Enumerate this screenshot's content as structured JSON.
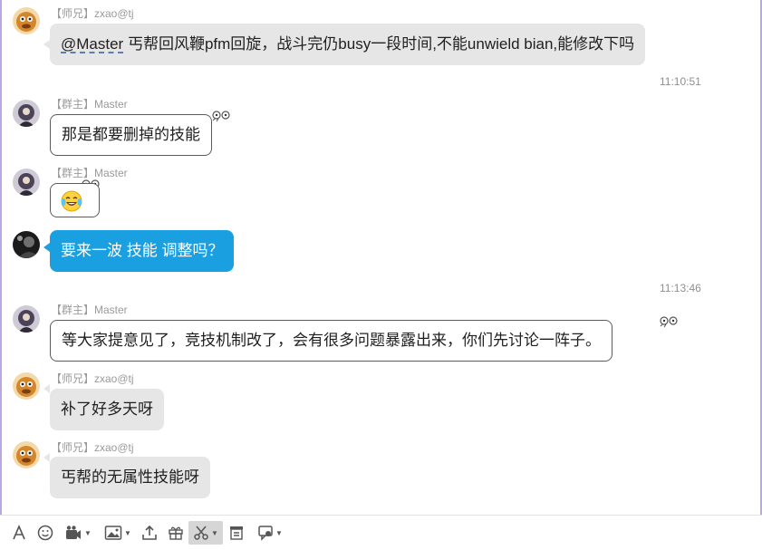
{
  "colors": {
    "bubble_gray": "#e6e6e6",
    "bubble_blue": "#1aa0e0",
    "outline": "#5b5b5b",
    "meta_text": "#9a9a9a"
  },
  "messages": [
    {
      "sender": "【师兄】zxao@tj",
      "mention": "@Master",
      "text": " 丐帮回风鞭pfm回旋，战斗完仍busy一段时间,不能unwield bian,能修改下吗"
    },
    {
      "sender": "【群主】Master",
      "text": "那是都要删掉的技能"
    },
    {
      "sender": "【群主】Master",
      "emoji": "laughing-tears-emoji"
    },
    {
      "text": "要来一波 技能 调整吗？"
    },
    {
      "sender": "【群主】Master",
      "text": "等大家提意见了，竞技机制改了，会有很多问题暴露出来，你们先讨论一阵子。"
    },
    {
      "sender": "【师兄】zxao@tj",
      "text": "补了好多天呀"
    },
    {
      "sender": "【师兄】zxao@tj",
      "text": "丐帮的无属性技能呀"
    }
  ],
  "timestamps": [
    "11:10:51",
    "11:13:46"
  ],
  "toolbar": {
    "icons": [
      "font-icon",
      "smiley-icon",
      "video-chat-icon",
      "image-icon",
      "upload-icon",
      "gift-icon",
      "scissors-icon",
      "clipboard-icon",
      "message-history-icon"
    ]
  }
}
